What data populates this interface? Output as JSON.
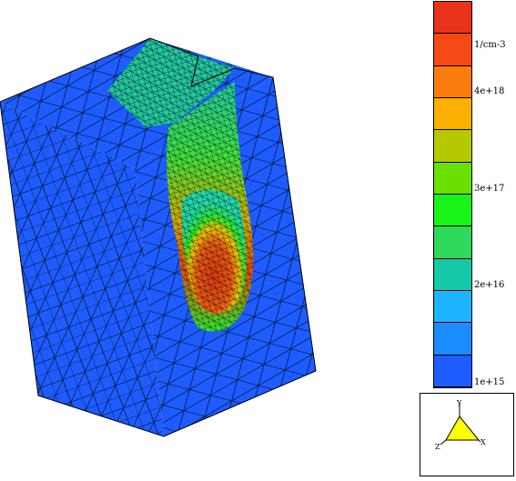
{
  "viewport": {
    "colors": {
      "background": "#ffffff",
      "base": "#1e5cff",
      "mesh": "#000000",
      "low_mid": "#22d8a8",
      "green": "#2ee82e",
      "yellow": "#e6e600",
      "orange": "#ff8800",
      "red": "#d83a10"
    }
  },
  "colorbar": {
    "unit_label": "1/cm-3",
    "tick_labels": [
      "4e+18",
      "3e+17",
      "2e+16",
      "1e+15"
    ],
    "bands": [
      "#e8321a",
      "#f64a16",
      "#fb7d10",
      "#fbb000",
      "#b4c800",
      "#6ae000",
      "#18f418",
      "#2ed85a",
      "#14c8a8",
      "#1cb4ff",
      "#1a8cff",
      "#1e5cff"
    ]
  },
  "orientation_triad": {
    "axes": [
      "Y",
      "X",
      "Z"
    ],
    "fill_color": "#ffff00"
  }
}
